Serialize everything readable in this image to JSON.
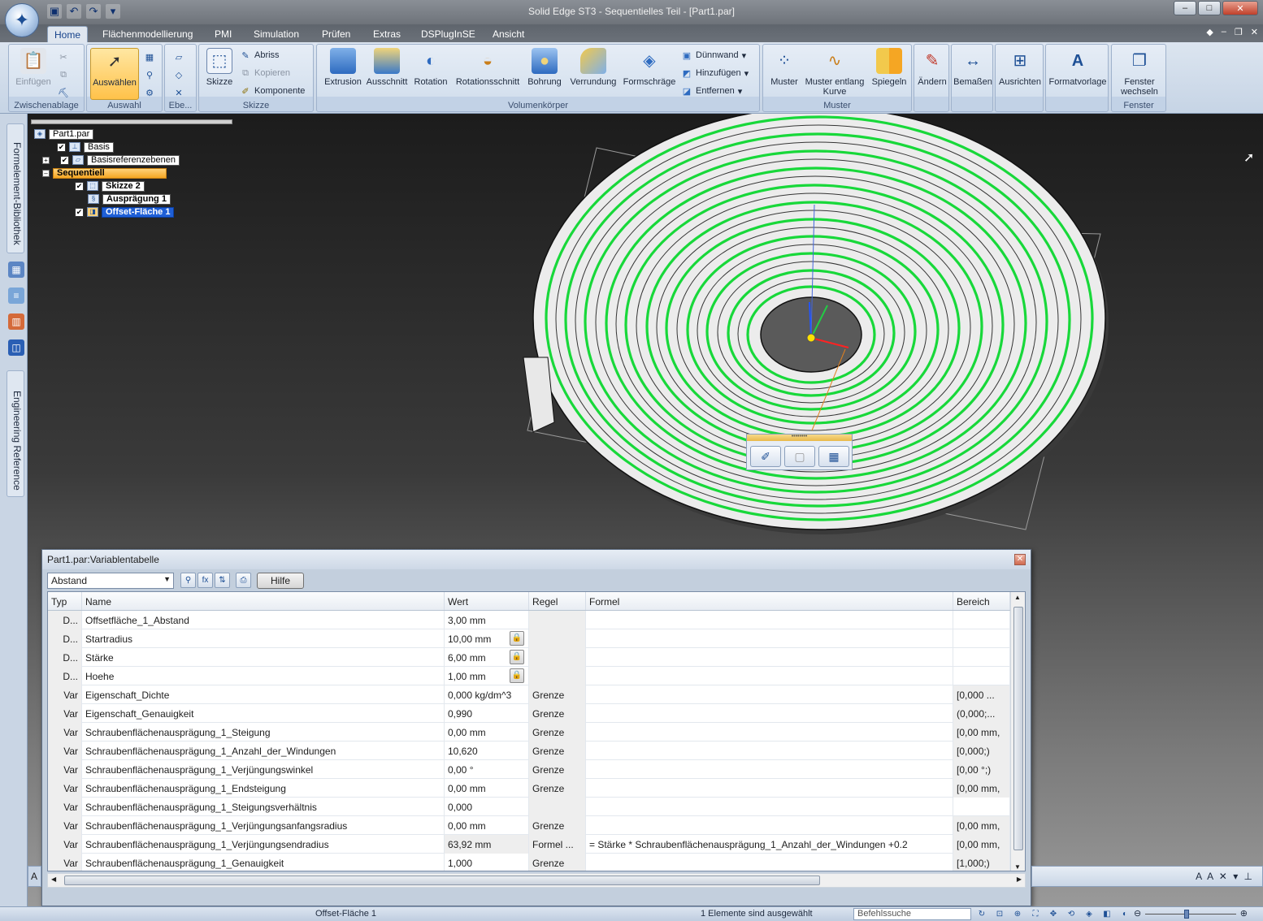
{
  "window": {
    "title": "Solid Edge ST3 - Sequentielles Teil - [Part1.par]",
    "controls": [
      "–",
      "□",
      "✕"
    ]
  },
  "ribbon_tabs": [
    "Home",
    "Flächenmodellierung",
    "PMI",
    "Simulation",
    "Prüfen",
    "Extras",
    "DSPlugInSE",
    "Ansicht"
  ],
  "ribbon": {
    "zwischenablage": {
      "label": "Zwischenablage",
      "einfuegen": "Einfügen"
    },
    "auswahl": {
      "label": "Auswahl",
      "auswaehlen": "Auswählen"
    },
    "ebenen": {
      "label": "Ebe..."
    },
    "skizze": {
      "label": "Skizze",
      "skizze_btn": "Skizze",
      "abriss": "Abriss",
      "kopieren": "Kopieren",
      "komponente": "Komponente"
    },
    "volumenkoerper": {
      "label": "Volumenkörper",
      "extrusion": "Extrusion",
      "ausschnitt": "Ausschnitt",
      "rotation": "Rotation",
      "rotationsschnitt": "Rotationsschnitt",
      "bohrung": "Bohrung",
      "verrundung": "Verrundung",
      "formschraege": "Formschräge",
      "duennwand": "Dünnwand",
      "hinzufuegen": "Hinzufügen",
      "entfernen": "Entfernen"
    },
    "muster": {
      "label": "Muster",
      "muster_btn": "Muster",
      "muster_kurve_1": "Muster entlang",
      "muster_kurve_2": "Kurve",
      "spiegeln": "Spiegeln"
    },
    "aendern": "Ändern",
    "bemassen": "Bemaßen",
    "ausrichten": "Ausrichten",
    "formatvorlage": "Formatvorlage",
    "fenster": {
      "label": "Fenster",
      "btn_1": "Fenster",
      "btn_2": "wechseln"
    }
  },
  "left_tabs": {
    "library": "Formelement-Bibliothek",
    "engineering": "Engineering Reference"
  },
  "tree": {
    "root": "Part1.par",
    "basis": "Basis",
    "basisreferenzebenen": "Basisreferenzebenen",
    "sequentiell": "Sequentiell",
    "skizze2": "Skizze 2",
    "auspraegung1": "Ausprägung 1",
    "offset1": "Offset-Fläche 1"
  },
  "colors": {
    "accent_green": "#18d83a",
    "selection_blue": "#1f5fd6",
    "feature_orange": "#f5a623"
  },
  "variable_table": {
    "title": "Part1.par:Variablentabelle",
    "filter_value": "Abstand",
    "help_button": "Hilfe",
    "headers": {
      "typ": "Typ",
      "name": "Name",
      "wert": "Wert",
      "regel": "Regel",
      "formel": "Formel",
      "bereich": "Bereich"
    },
    "rows": [
      {
        "typ": "D...",
        "name": "Offsetfläche_1_Abstand",
        "wert": "3,00 mm",
        "locked": false,
        "regel": "",
        "formel": "",
        "bereich": ""
      },
      {
        "typ": "D...",
        "name": "Startradius",
        "wert": "10,00 mm",
        "locked": true,
        "regel": "",
        "formel": "",
        "bereich": ""
      },
      {
        "typ": "D...",
        "name": "Stärke",
        "wert": "6,00 mm",
        "locked": true,
        "regel": "",
        "formel": "",
        "bereich": ""
      },
      {
        "typ": "D...",
        "name": "Hoehe",
        "wert": "1,00 mm",
        "locked": true,
        "regel": "",
        "formel": "",
        "bereich": ""
      },
      {
        "typ": "Var",
        "name": "Eigenschaft_Dichte",
        "wert": "0,000 kg/dm^3",
        "locked": false,
        "regel": "Grenze",
        "formel": "",
        "bereich": "[0,000 ..."
      },
      {
        "typ": "Var",
        "name": "Eigenschaft_Genauigkeit",
        "wert": "0,990",
        "locked": false,
        "regel": "Grenze",
        "formel": "",
        "bereich": "(0,000;..."
      },
      {
        "typ": "Var",
        "name": "Schraubenflächenausprägung_1_Steigung",
        "wert": "0,00 mm",
        "locked": false,
        "regel": "Grenze",
        "formel": "",
        "bereich": "[0,00 mm,"
      },
      {
        "typ": "Var",
        "name": "Schraubenflächenausprägung_1_Anzahl_der_Windungen",
        "wert": "10,620",
        "locked": false,
        "regel": "Grenze",
        "formel": "",
        "bereich": "[0,000;)"
      },
      {
        "typ": "Var",
        "name": "Schraubenflächenausprägung_1_Verjüngungswinkel",
        "wert": "0,00 °",
        "locked": false,
        "regel": "Grenze",
        "formel": "",
        "bereich": "[0,00 °;)"
      },
      {
        "typ": "Var",
        "name": "Schraubenflächenausprägung_1_Endsteigung",
        "wert": "0,00 mm",
        "locked": false,
        "regel": "Grenze",
        "formel": "",
        "bereich": "[0,00 mm,"
      },
      {
        "typ": "Var",
        "name": "Schraubenflächenausprägung_1_Steigungsverhältnis",
        "wert": "0,000",
        "locked": false,
        "regel": "",
        "formel": "",
        "bereich": ""
      },
      {
        "typ": "Var",
        "name": "Schraubenflächenausprägung_1_Verjüngungsanfangsradius",
        "wert": "0,00 mm",
        "locked": false,
        "regel": "Grenze",
        "formel": "",
        "bereich": "[0,00 mm,"
      },
      {
        "typ": "Var",
        "name": "Schraubenflächenausprägung_1_Verjüngungsendradius",
        "wert": "63,92 mm",
        "locked": false,
        "regel": "Formel ...",
        "formel": "= Stärke * Schraubenflächenausprägung_1_Anzahl_der_Windungen +0.2",
        "bereich": "[0,00 mm,"
      },
      {
        "typ": "Var",
        "name": "Schraubenflächenausprägung_1_Genauigkeit",
        "wert": "1,000",
        "locked": false,
        "regel": "Grenze",
        "formel": "",
        "bereich": "[1,000;)"
      }
    ]
  },
  "status": {
    "selection_name": "Offset-Fläche 1",
    "selection_count": "1 Elemente sind ausgewählt",
    "search_placeholder": "Befehlssuche"
  }
}
